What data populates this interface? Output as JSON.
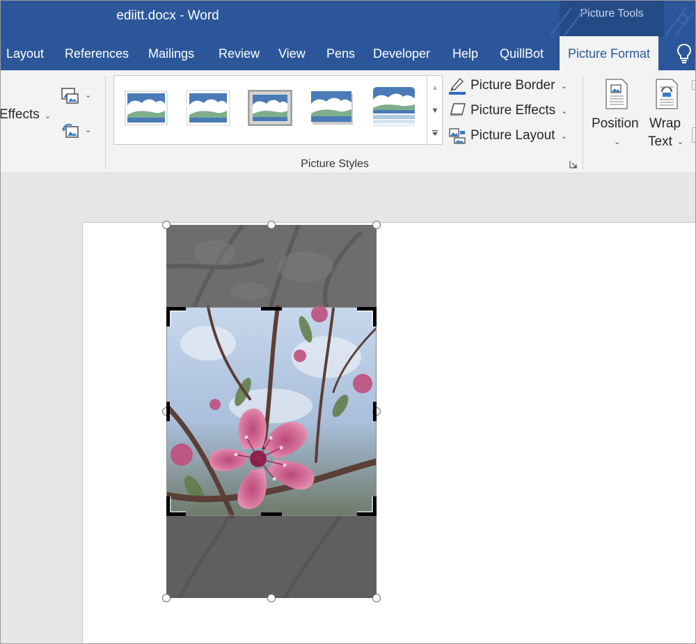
{
  "window": {
    "title": "ediitt.docx  -  Word"
  },
  "contextual_group": {
    "label": "Picture Tools"
  },
  "tabs": [
    {
      "label": "Layout",
      "active": false
    },
    {
      "label": "References",
      "active": false
    },
    {
      "label": "Mailings",
      "active": false
    },
    {
      "label": "Review",
      "active": false
    },
    {
      "label": "View",
      "active": false
    },
    {
      "label": "Pens",
      "active": false
    },
    {
      "label": "Developer",
      "active": false
    },
    {
      "label": "Help",
      "active": false
    },
    {
      "label": "QuillBot",
      "active": false
    },
    {
      "label": "Picture Format",
      "active": true
    }
  ],
  "ribbon": {
    "left_partial_label": "Effects",
    "picture_styles": {
      "label": "Picture Styles",
      "thumbnail_count": 5,
      "selected_index": 2
    },
    "commands": [
      {
        "label": "Picture Border",
        "icon": "picture-border-icon"
      },
      {
        "label": "Picture Effects",
        "icon": "picture-effects-icon"
      },
      {
        "label": "Picture Layout",
        "icon": "picture-layout-icon"
      }
    ],
    "arrange": {
      "position_label": "Position",
      "wrap_text_line1": "Wrap",
      "wrap_text_line2": "Text"
    }
  },
  "colors": {
    "title_bar": "#2b579a",
    "contextual_group": "#254b87",
    "ribbon": "#f3f3f3",
    "active_tab_text": "#2b579a",
    "canvas": "#e6e6e6"
  },
  "icons": {
    "tell_me": "lightbulb-icon",
    "dropdown": "chevron-down-icon",
    "dialog_launcher": "dialog-launcher-icon"
  }
}
